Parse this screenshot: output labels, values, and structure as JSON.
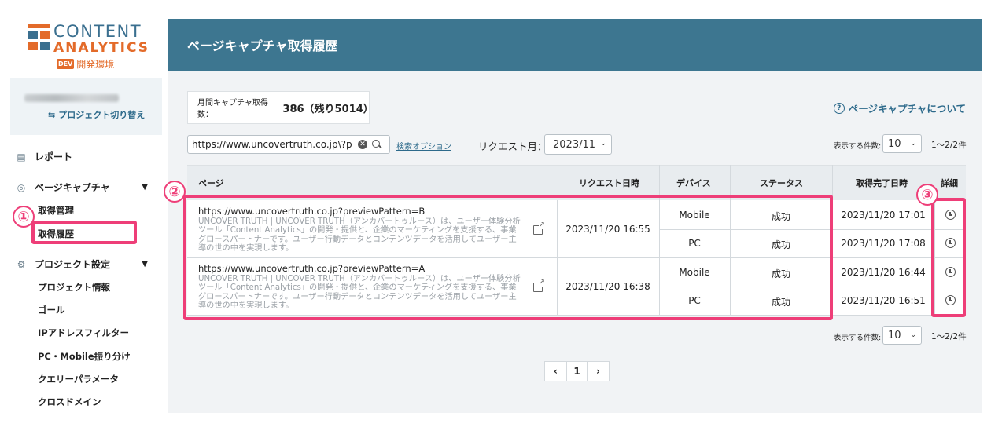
{
  "logo": {
    "line1": "CONTENT",
    "line2": "ANALYTICS",
    "badge": "DEV",
    "env": "開発環境"
  },
  "project": {
    "switch_label": "プロジェクト切り替え"
  },
  "sidebar": {
    "report": "レポート",
    "page_capture": "ページキャプチャ",
    "capture_sub": [
      "取得管理",
      "取得履歴"
    ],
    "project_settings": "プロジェクト設定",
    "settings_sub": [
      "プロジェクト情報",
      "ゴール",
      "IPアドレスフィルター",
      "PC・Mobile振り分け",
      "クエリーパラメータ",
      "クロスドメイン"
    ]
  },
  "header": {
    "title": "ページキャプチャ取得履歴"
  },
  "summary": {
    "label": "月間キャプチャ取得数：",
    "value": "386（残り5014）"
  },
  "about_link": "ページキャプチャについて",
  "search": {
    "value": "https://www.uncovertruth.co.jp\\?p",
    "options_link": "検索オプション"
  },
  "request_month": {
    "label": "リクエスト月：",
    "value": "2023/11"
  },
  "display_count": {
    "label": "表示する件数:",
    "value": "10",
    "range": "1〜2/2件"
  },
  "table": {
    "headers": [
      "ページ",
      "リクエスト日時",
      "デバイス",
      "ステータス",
      "取得完了日時",
      "詳細"
    ],
    "rows": [
      {
        "url": "https://www.uncovertruth.co.jp?previewPattern=B",
        "desc": "UNCOVER TRUTH | UNCOVER TRUTH（アンカバートゥルース）は、ユーザー体験分析ツール「Content Analytics」の開発・提供と、企業のマーケティングを支援する、事業グロースパートナーです。ユーザー行動データとコンテンツデータを活用してユーザー主導の世の中を実現します。",
        "request": "2023/11/20 16:55",
        "devices": [
          {
            "device": "Mobile",
            "status": "成功",
            "done": "2023/11/20 17:01"
          },
          {
            "device": "PC",
            "status": "成功",
            "done": "2023/11/20 17:08"
          }
        ]
      },
      {
        "url": "https://www.uncovertruth.co.jp?previewPattern=A",
        "desc": "UNCOVER TRUTH | UNCOVER TRUTH（アンカバートゥルース）は、ユーザー体験分析ツール「Content Analytics」の開発・提供と、企業のマーケティングを支援する、事業グロースパートナーです。ユーザー行動データとコンテンツデータを活用してユーザー主導の世の中を実現します。",
        "request": "2023/11/20 16:38",
        "devices": [
          {
            "device": "Mobile",
            "status": "成功",
            "done": "2023/11/20 16:44"
          },
          {
            "device": "PC",
            "status": "成功",
            "done": "2023/11/20 16:51"
          }
        ]
      }
    ]
  },
  "pagination": {
    "prev": "‹",
    "page": "1",
    "next": "›"
  },
  "annotations": [
    "①",
    "②",
    "③"
  ],
  "colors": {
    "header": "#3d7690",
    "accent": "#e36b2a",
    "highlight": "#ee3e78",
    "link": "#2d6a8b"
  }
}
